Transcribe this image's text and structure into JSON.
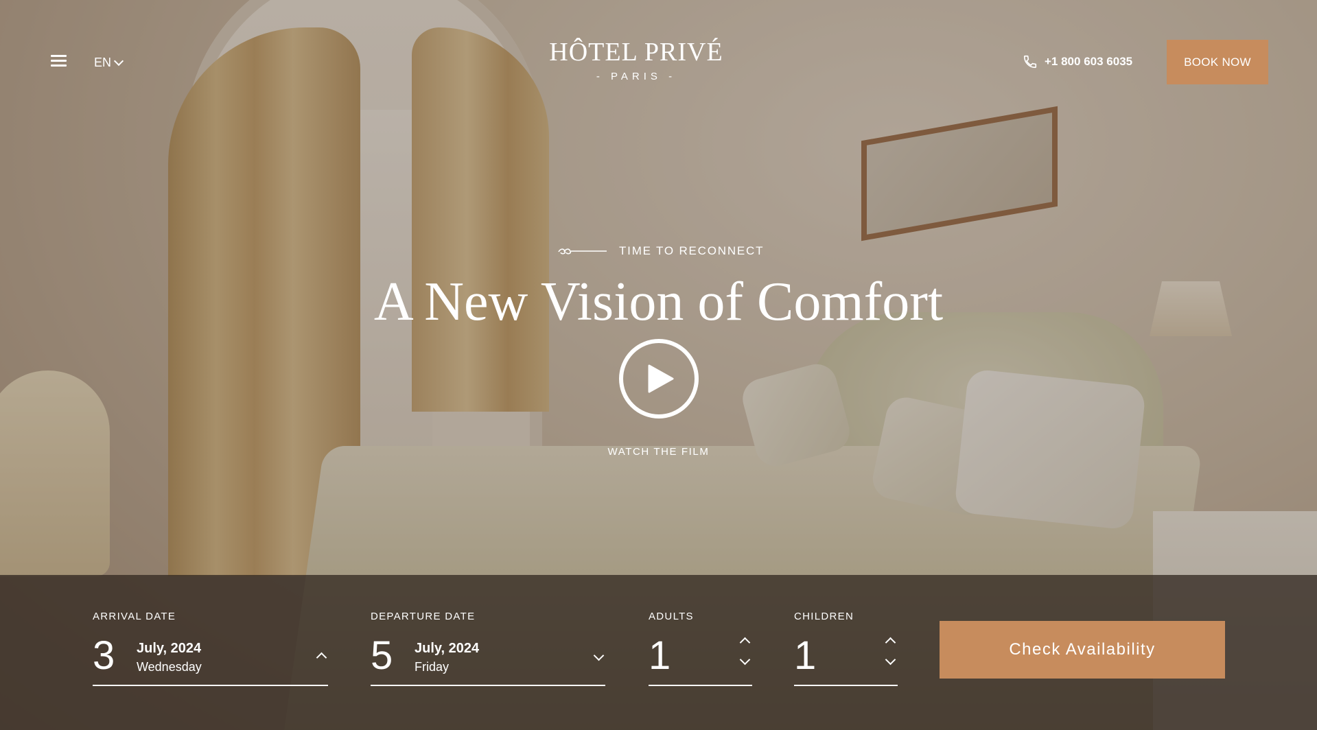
{
  "header": {
    "language": "EN",
    "logo_name": "HÔTEL PRIVÉ",
    "logo_city": "- PARIS -",
    "phone": "+1 800 603 6035",
    "book_label": "BOOK NOW"
  },
  "hero": {
    "eyebrow": "TIME TO RECONNECT",
    "title": "A New Vision of Comfort",
    "watch_label": "WATCH THE FILM"
  },
  "booking": {
    "arrival": {
      "label": "ARRIVAL DATE",
      "day": "3",
      "month": "July, 2024",
      "weekday": "Wednesday"
    },
    "departure": {
      "label": "DEPARTURE DATE",
      "day": "5",
      "month": "July, 2024",
      "weekday": "Friday"
    },
    "adults": {
      "label": "ADULTS",
      "value": "1"
    },
    "children": {
      "label": "CHILDREN",
      "value": "1"
    },
    "submit_label": "Check Availability"
  },
  "colors": {
    "accent": "#c78c5d",
    "booking_bar": "#342a22"
  },
  "icons": [
    "menu-icon",
    "chevron-down-icon",
    "phone-icon",
    "ornament-icon",
    "play-icon",
    "chevron-up-icon"
  ]
}
